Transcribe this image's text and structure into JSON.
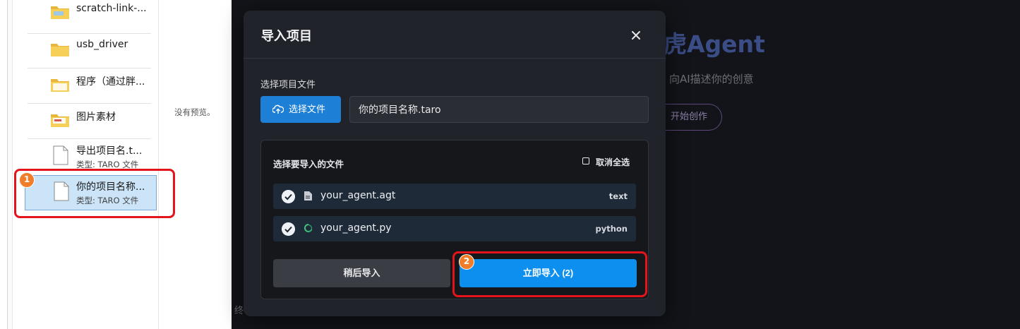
{
  "file_panel": {
    "items": [
      {
        "name": "scratch-link-...",
        "kind": "folder"
      },
      {
        "name": "usb_driver",
        "kind": "folder"
      },
      {
        "name": "程序（通过胖...",
        "kind": "folder"
      },
      {
        "name": "图片素材",
        "kind": "folder"
      },
      {
        "name": "导出项目名.t...",
        "type": "类型: TARO 文件",
        "kind": "file"
      },
      {
        "name": "你的项目名称...",
        "type": "类型: TARO 文件",
        "kind": "file",
        "selected": true
      }
    ],
    "no_preview": "没有预览。"
  },
  "app": {
    "title": "虎Agent",
    "subtitle": "向AI描述你的创意",
    "start_button": "开始创作",
    "bottom_fragment": "终"
  },
  "modal": {
    "title": "导入项目",
    "select_label": "选择项目文件",
    "choose_button": "选择文件",
    "filename": "你的项目名称.taro",
    "files_box_title": "选择要导入的文件",
    "deselect_all": "取消全选",
    "files": [
      {
        "name": "your_agent.agt",
        "tag": "text",
        "icon": "document-icon"
      },
      {
        "name": "your_agent.py",
        "tag": "python",
        "icon": "python-icon"
      }
    ],
    "later_button": "稍后导入",
    "import_button": "立即导入 (2)"
  },
  "annotations": {
    "step1": "1",
    "step2": "2",
    "highlight_color": "#e3141b",
    "badge_color": "#ef7d2a"
  },
  "colors": {
    "accent": "#0c8fef",
    "modal_bg": "#202329",
    "app_bg": "#131419"
  }
}
